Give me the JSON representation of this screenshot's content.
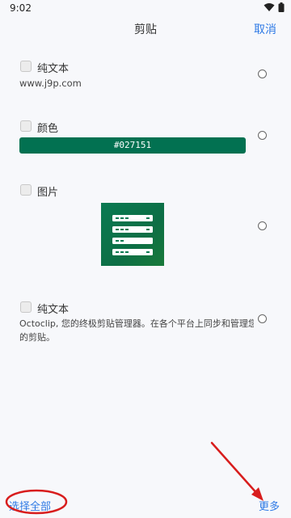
{
  "status": {
    "time": "9:02"
  },
  "header": {
    "title": "剪贴",
    "cancel_label": "取消"
  },
  "items": [
    {
      "type_label": "纯文本",
      "content": "www.j9p.com"
    },
    {
      "type_label": "颜色",
      "color_value": "#027151",
      "swatch": "#027151"
    },
    {
      "type_label": "图片"
    },
    {
      "type_label": "纯文本",
      "content_line1": "Octoclip, 您的终极剪贴管理器。在各个平台上同步和管理您",
      "content_line2": "的剪贴。"
    }
  ],
  "footer": {
    "select_all_label": "选择全部",
    "more_label": "更多"
  },
  "colors": {
    "accent": "#2f7ae5",
    "annotation": "#d81d1d",
    "image_green": "#0a7a52"
  }
}
